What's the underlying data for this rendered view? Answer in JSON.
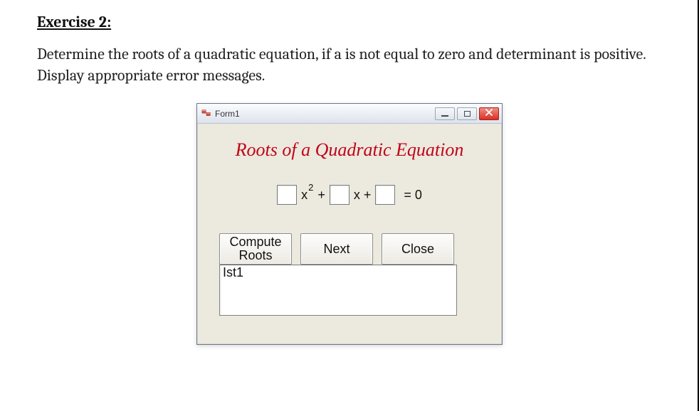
{
  "exercise": {
    "heading": "Exercise 2:",
    "description": "Determine the roots of a quadratic equation, if a is not equal to zero and determinant is positive. Display appropriate error messages."
  },
  "window": {
    "title": "Form1",
    "form_title": "Roots of a Quadratic Equation",
    "equation": {
      "x2_label": "x",
      "sup_label": "2",
      "plus1": "+",
      "x_label": "x +",
      "equals_zero": "= 0"
    },
    "inputs": {
      "a": "",
      "b": "",
      "c": ""
    },
    "buttons": {
      "compute": "Compute Roots",
      "next": "Next",
      "close": "Close"
    },
    "listbox": {
      "first_item": "Ist1"
    }
  }
}
